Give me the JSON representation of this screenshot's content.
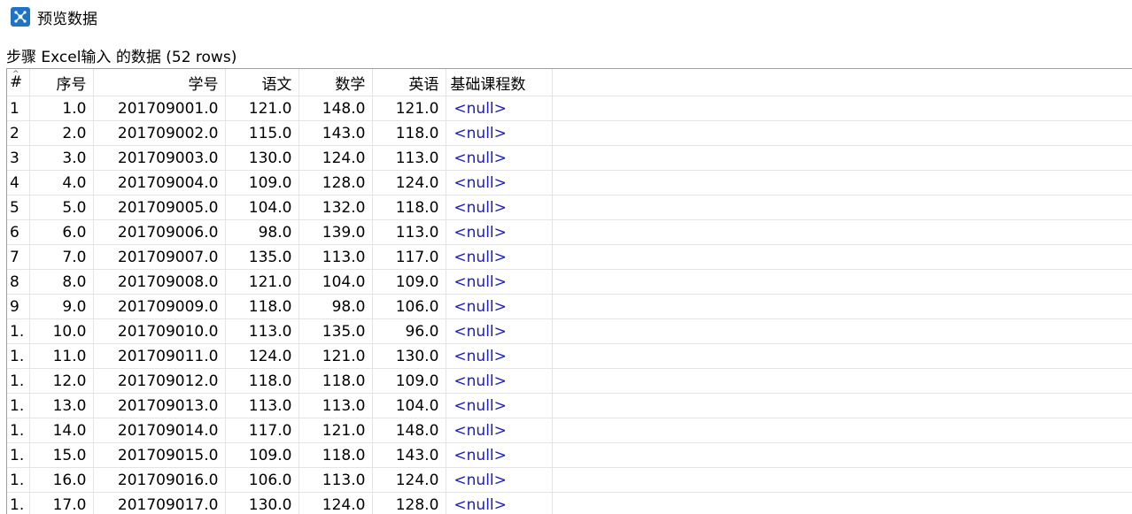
{
  "window": {
    "title": "预览数据",
    "icon": "network-nodes-icon",
    "accent": "#1f73c7"
  },
  "subtitle": "步骤 Excel输入 的数据  (52 rows)",
  "table": {
    "columns": [
      "#",
      "序号",
      "学号",
      "语文",
      "数学",
      "英语",
      "基础课程数"
    ],
    "rows": [
      [
        "1",
        "1.0",
        "201709001.0",
        "121.0",
        "148.0",
        "121.0",
        "<null>"
      ],
      [
        "2",
        "2.0",
        "201709002.0",
        "115.0",
        "143.0",
        "118.0",
        "<null>"
      ],
      [
        "3",
        "3.0",
        "201709003.0",
        "130.0",
        "124.0",
        "113.0",
        "<null>"
      ],
      [
        "4",
        "4.0",
        "201709004.0",
        "109.0",
        "128.0",
        "124.0",
        "<null>"
      ],
      [
        "5",
        "5.0",
        "201709005.0",
        "104.0",
        "132.0",
        "118.0",
        "<null>"
      ],
      [
        "6",
        "6.0",
        "201709006.0",
        "98.0",
        "139.0",
        "113.0",
        "<null>"
      ],
      [
        "7",
        "7.0",
        "201709007.0",
        "135.0",
        "113.0",
        "117.0",
        "<null>"
      ],
      [
        "8",
        "8.0",
        "201709008.0",
        "121.0",
        "104.0",
        "109.0",
        "<null>"
      ],
      [
        "9",
        "9.0",
        "201709009.0",
        "118.0",
        "98.0",
        "106.0",
        "<null>"
      ],
      [
        "1.",
        "10.0",
        "201709010.0",
        "113.0",
        "135.0",
        "96.0",
        "<null>"
      ],
      [
        "1.",
        "11.0",
        "201709011.0",
        "124.0",
        "121.0",
        "130.0",
        "<null>"
      ],
      [
        "1.",
        "12.0",
        "201709012.0",
        "118.0",
        "118.0",
        "109.0",
        "<null>"
      ],
      [
        "1.",
        "13.0",
        "201709013.0",
        "113.0",
        "113.0",
        "104.0",
        "<null>"
      ],
      [
        "1.",
        "14.0",
        "201709014.0",
        "117.0",
        "121.0",
        "148.0",
        "<null>"
      ],
      [
        "1.",
        "15.0",
        "201709015.0",
        "109.0",
        "118.0",
        "143.0",
        "<null>"
      ],
      [
        "1.",
        "16.0",
        "201709016.0",
        "106.0",
        "113.0",
        "124.0",
        "<null>"
      ],
      [
        "1.",
        "17.0",
        "201709017.0",
        "130.0",
        "124.0",
        "128.0",
        "<null>"
      ]
    ]
  },
  "colors": {
    "null_text": "#1a1acc",
    "grid_line": "#e4e4e4"
  }
}
